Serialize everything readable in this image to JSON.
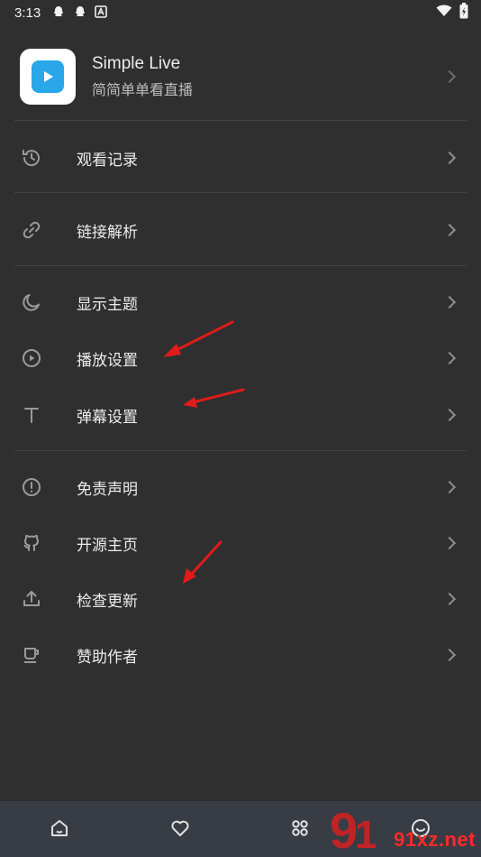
{
  "status_bar": {
    "time": "3:13"
  },
  "app": {
    "name": "Simple Live",
    "subtitle": "简简单单看直播",
    "logo_color": "#2aa7e8"
  },
  "menu": {
    "history": "观看记录",
    "link_parse": "链接解析",
    "theme": "显示主题",
    "play_settings": "播放设置",
    "danmaku_settings": "弹幕设置",
    "disclaimer": "免责声明",
    "open_source": "开源主页",
    "check_update": "检查更新",
    "sponsor": "赞助作者"
  },
  "watermark": {
    "text": "91xz.net"
  },
  "colors": {
    "background": "#2f2f2f",
    "nav_background": "#383c44",
    "annotation_arrow": "#e01b1b"
  }
}
